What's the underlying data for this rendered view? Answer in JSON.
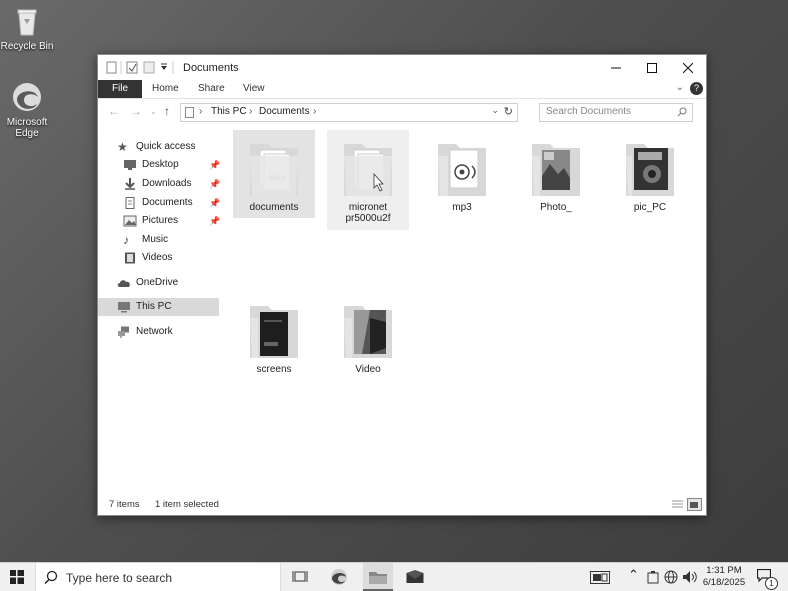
{
  "desktop": {
    "icons": [
      {
        "label": "Recycle Bin"
      },
      {
        "label": "Microsoft Edge"
      }
    ]
  },
  "window": {
    "title": "Documents",
    "ribbon_tabs": [
      "File",
      "Home",
      "Share",
      "View"
    ],
    "help_glyph": "?",
    "address": {
      "crumbs": [
        "This PC",
        "Documents"
      ]
    },
    "search_placeholder": "Search Documents",
    "sidebar": {
      "items": [
        {
          "label": "Quick access",
          "icon": "star-icon"
        },
        {
          "label": "Desktop",
          "icon": "desktop-icon",
          "pinned": true
        },
        {
          "label": "Downloads",
          "icon": "download-icon",
          "pinned": true
        },
        {
          "label": "Documents",
          "icon": "document-icon",
          "pinned": true
        },
        {
          "label": "Pictures",
          "icon": "pictures-icon",
          "pinned": true
        },
        {
          "label": "Music",
          "icon": "music-icon"
        },
        {
          "label": "Videos",
          "icon": "videos-icon"
        },
        {
          "label": "OneDrive",
          "icon": "cloud-icon"
        },
        {
          "label": "This PC",
          "icon": "computer-icon",
          "selected": true
        },
        {
          "label": "Network",
          "icon": "network-icon"
        }
      ]
    },
    "folders": [
      {
        "name": "documents",
        "state": "selected"
      },
      {
        "name": "micronet pr5000u2f",
        "state": "hover"
      },
      {
        "name": "mp3",
        "state": "normal"
      },
      {
        "name": "Photo_",
        "state": "normal"
      },
      {
        "name": "pic_PC",
        "state": "normal"
      },
      {
        "name": "screens",
        "state": "normal"
      },
      {
        "name": "Video",
        "state": "normal"
      }
    ],
    "status": {
      "count": "7 items",
      "selection": "1 item selected"
    }
  },
  "taskbar": {
    "search_placeholder": "Type here to search",
    "time": "1:31 PM",
    "date": "6/18/2025",
    "notification_count": "1"
  }
}
